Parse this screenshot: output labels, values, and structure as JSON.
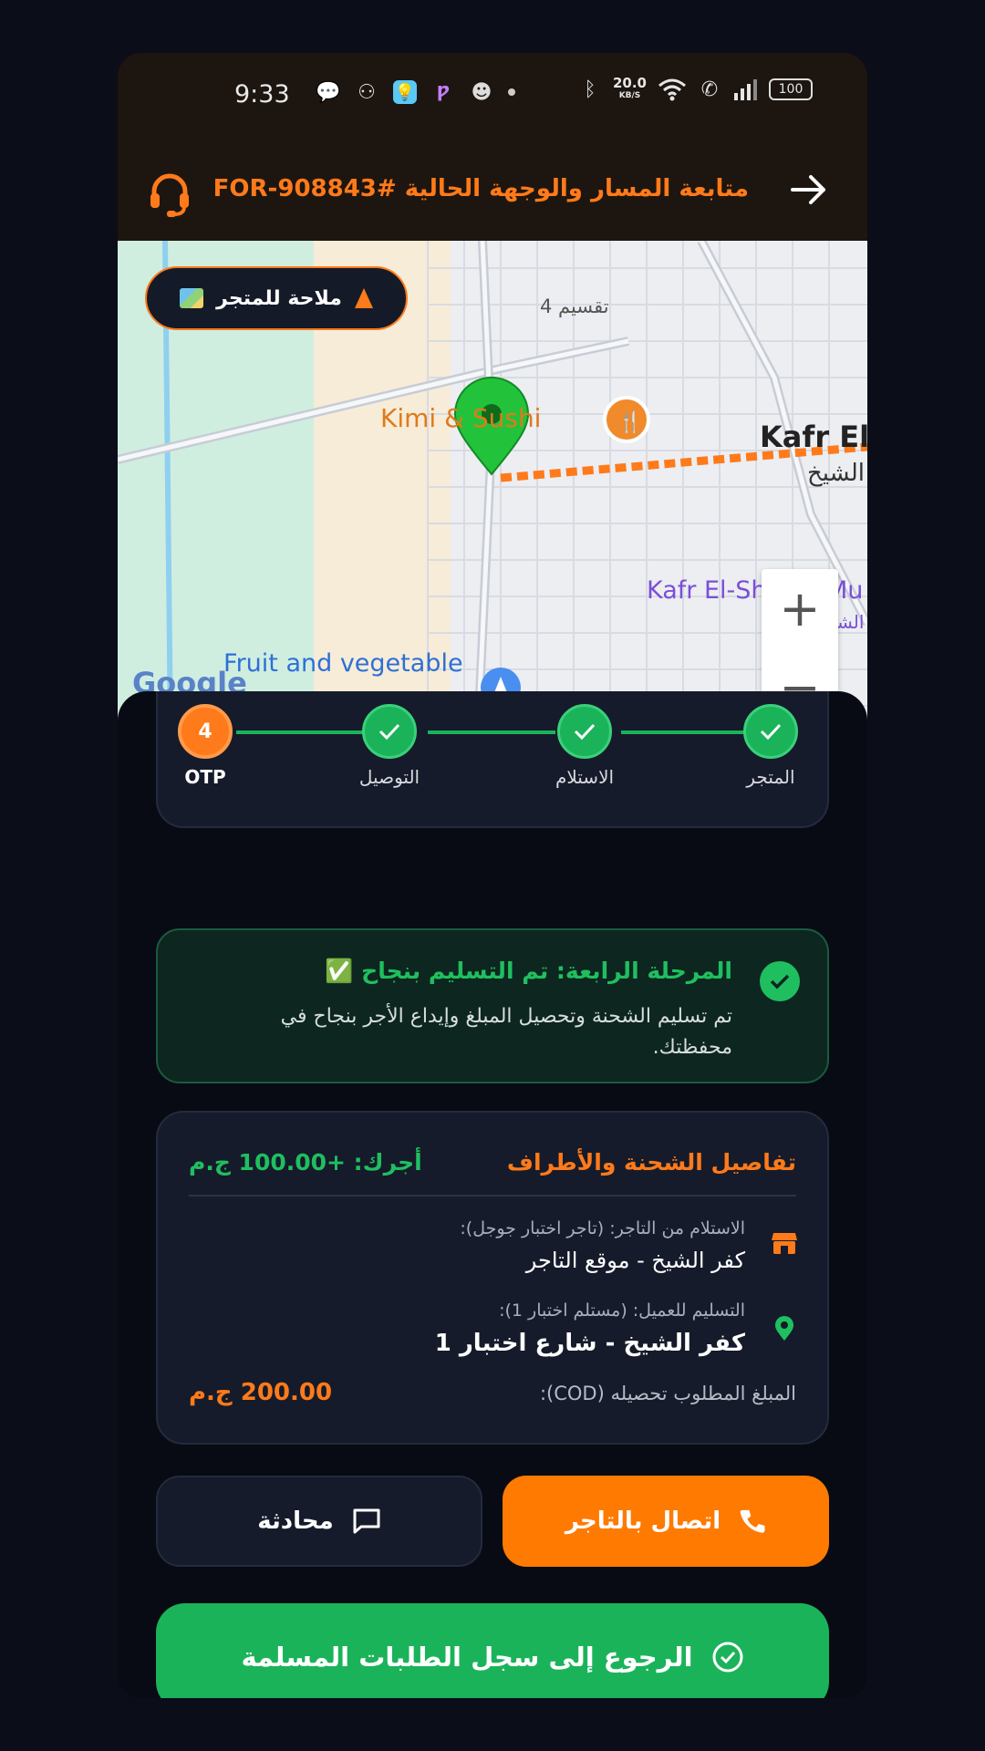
{
  "status_bar": {
    "time": "9:33",
    "speed": "20.0",
    "speed_unit": "KB/S",
    "battery": "100"
  },
  "header": {
    "title": "متابعة المسار والوجهة الحالية #FOR-908843",
    "support_icon": "headset-icon",
    "back_icon": "arrow-right-icon"
  },
  "map": {
    "navigate_button": "ملاحة للمتجر",
    "labels": {
      "district": "تقسيم 4",
      "restaurant": "Kimi & Sushi",
      "city": "Kafr El-",
      "city_ar": "الشيخ",
      "museum": "Kafr El-Sheikh Mu",
      "museum_ar": "الشيخ",
      "market": "Fruit and vegetable",
      "provider": "Google"
    },
    "zoom_in": "+",
    "zoom_out": "−",
    "colors": {
      "route": "#ff7a1a",
      "pin": "#22c33a"
    }
  },
  "steps": [
    {
      "label": "المتجر",
      "state": "done"
    },
    {
      "label": "الاستلام",
      "state": "done"
    },
    {
      "label": "التوصيل",
      "state": "done"
    },
    {
      "label": "OTP",
      "number": "4",
      "state": "current"
    }
  ],
  "success": {
    "title": "المرحلة الرابعة: تم التسليم بنجاح ✅",
    "text": "تم تسليم الشحنة وتحصيل المبلغ وإيداع الأجر بنجاح في محفظتك."
  },
  "details": {
    "title": "تفاصيل الشحنة والأطراف",
    "fee": "أجرك: +100.00 ج.م",
    "pickup_label": "الاستلام من التاجر: (تاجر اختبار جوجل):",
    "pickup_value": "كفر الشيخ - موقع التاجر",
    "dropoff_label": "التسليم للعميل: (مستلم اختبار 1):",
    "dropoff_value": "كفر الشيخ - شارع اختبار 1",
    "cod_label": "المبلغ المطلوب تحصيله (COD):",
    "cod_value": "200.00 ج.م"
  },
  "actions": {
    "call": "اتصال بالتاجر",
    "chat": "محادثة",
    "back": "الرجوع إلى سجل الطلبات المسلمة"
  },
  "colors": {
    "accent": "#ff7a00",
    "success": "#1bb35a",
    "card": "#151b2a",
    "background": "#080b14"
  }
}
